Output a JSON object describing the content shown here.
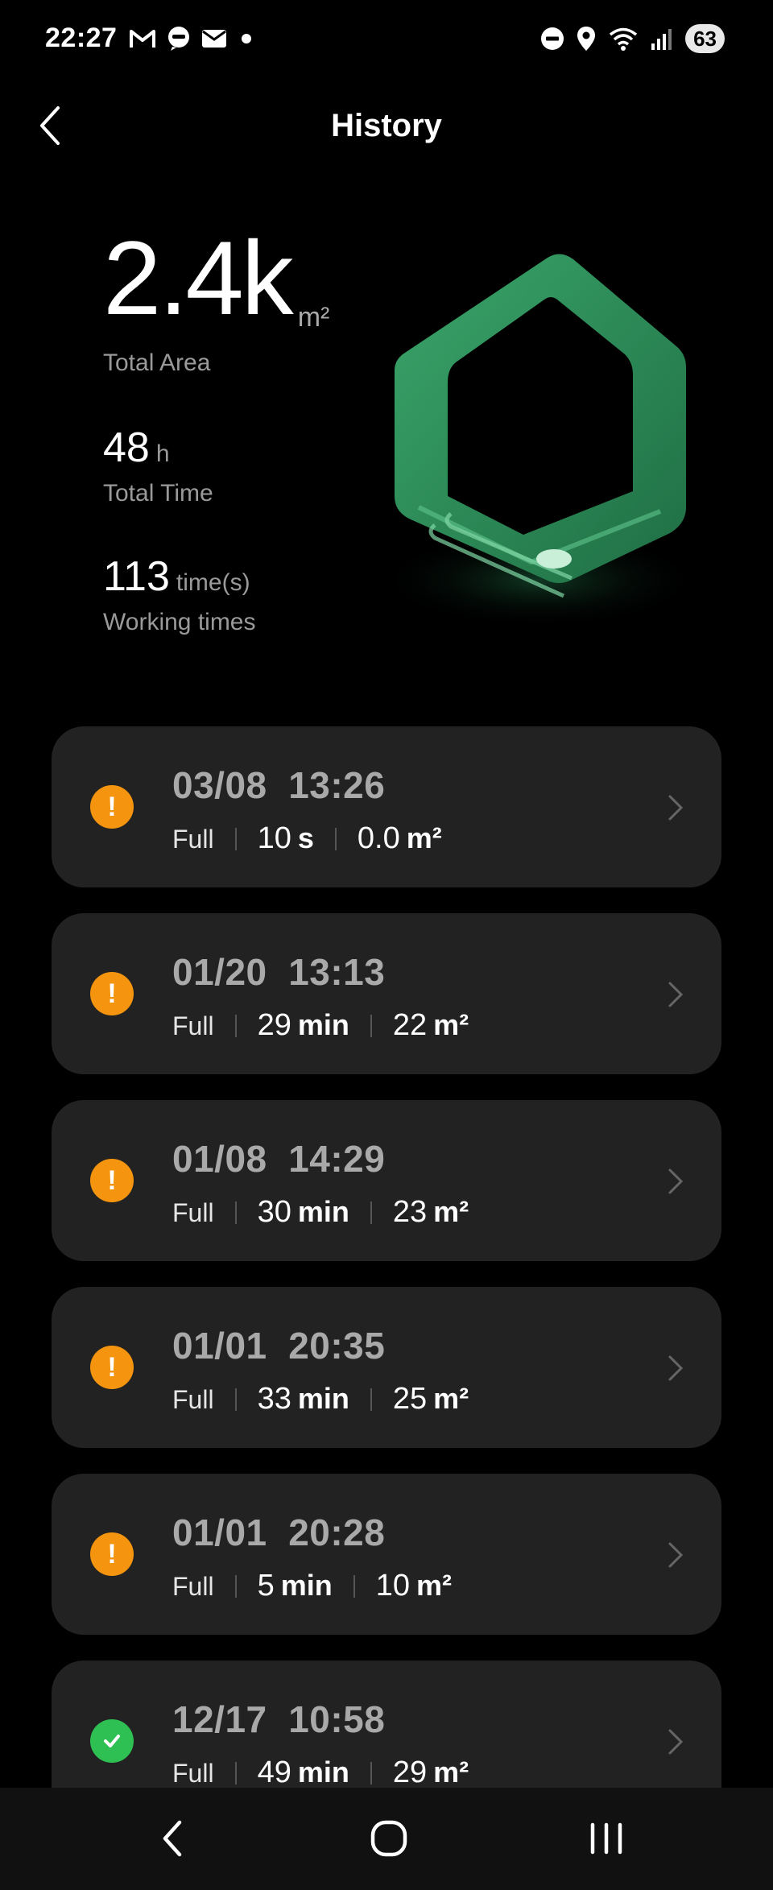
{
  "status_bar": {
    "time": "22:27",
    "notification_icons": [
      "gmail-icon",
      "chat-icon",
      "mail-icon",
      "dot-icon"
    ],
    "system_icons": [
      "dnd-icon",
      "location-icon",
      "wifi-icon",
      "signal-icon"
    ],
    "battery": "63"
  },
  "header": {
    "title": "History"
  },
  "stats": {
    "total_area_value": "2.4k",
    "total_area_unit": "m²",
    "total_area_label": "Total Area",
    "total_time_value": "48",
    "total_time_unit": "h",
    "total_time_label": "Total Time",
    "working_times_value": "113",
    "working_times_unit": "time(s)",
    "working_times_label": "Working times"
  },
  "history": [
    {
      "status": "warning",
      "date": "03/08",
      "time": "13:26",
      "mode": "Full",
      "duration": "10",
      "duration_unit": "s",
      "area": "0.0",
      "area_unit": "m²"
    },
    {
      "status": "warning",
      "date": "01/20",
      "time": "13:13",
      "mode": "Full",
      "duration": "29",
      "duration_unit": "min",
      "area": "22",
      "area_unit": "m²"
    },
    {
      "status": "warning",
      "date": "01/08",
      "time": "14:29",
      "mode": "Full",
      "duration": "30",
      "duration_unit": "min",
      "area": "23",
      "area_unit": "m²"
    },
    {
      "status": "warning",
      "date": "01/01",
      "time": "20:35",
      "mode": "Full",
      "duration": "33",
      "duration_unit": "min",
      "area": "25",
      "area_unit": "m²"
    },
    {
      "status": "warning",
      "date": "01/01",
      "time": "20:28",
      "mode": "Full",
      "duration": "5",
      "duration_unit": "min",
      "area": "10",
      "area_unit": "m²"
    },
    {
      "status": "success",
      "date": "12/17",
      "time": "10:58",
      "mode": "Full",
      "duration": "49",
      "duration_unit": "min",
      "area": "29",
      "area_unit": "m²"
    }
  ],
  "colors": {
    "warning": "#f5950f",
    "success": "#2ec052",
    "card_bg": "#222222",
    "house_green": "#2e8b57"
  },
  "navbar": {
    "buttons": [
      "back-icon",
      "home-icon",
      "recents-icon"
    ]
  }
}
